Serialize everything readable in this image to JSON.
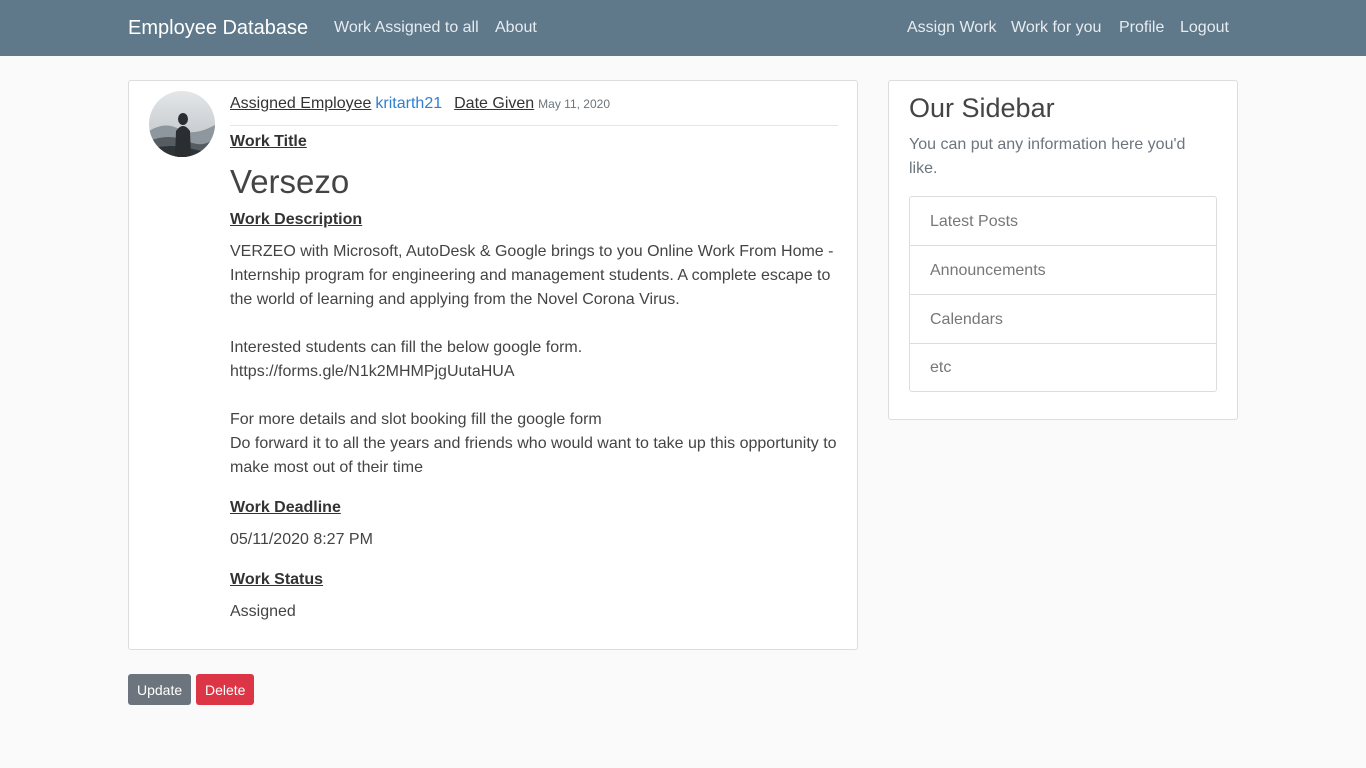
{
  "navbar": {
    "brand": "Employee Database",
    "left_links": [
      "Work Assigned to all",
      "About"
    ],
    "right_links": [
      "Assign Work",
      "Work for you",
      "Profile",
      "Logout"
    ]
  },
  "post": {
    "assigned_label": "Assigned Employee",
    "author": "kritarth21",
    "date_label": "Date Given",
    "date": "May 11, 2020",
    "title_label": "Work Title",
    "title": "Versezo",
    "description_label": "Work Description",
    "description": "VERZEO with Microsoft, AutoDesk & Google brings to you Online Work From Home - Internship program for engineering and management students. A complete escape to the world of learning and applying from the Novel Corona Virus.\n\nInterested students can fill the below google form.\nhttps://forms.gle/N1k2MHMPjgUutaHUA\n\nFor more details and slot booking fill the google form\nDo forward it to all the years and friends who would want to take up this opportunity to make most out of their time",
    "deadline_label": "Work Deadline",
    "deadline": "05/11/2020 8:27 PM",
    "status_label": "Work Status",
    "status": "Assigned"
  },
  "actions": {
    "update": "Update",
    "delete": "Delete"
  },
  "sidebar": {
    "title": "Our Sidebar",
    "lead": "You can put any information here you'd like.",
    "items": [
      "Latest Posts",
      "Announcements",
      "Calendars",
      "etc"
    ]
  },
  "colors": {
    "navbar": "#5f788a",
    "link": "#2f7fd2",
    "update_button": "#6c757d",
    "delete_button": "#dc3545"
  }
}
